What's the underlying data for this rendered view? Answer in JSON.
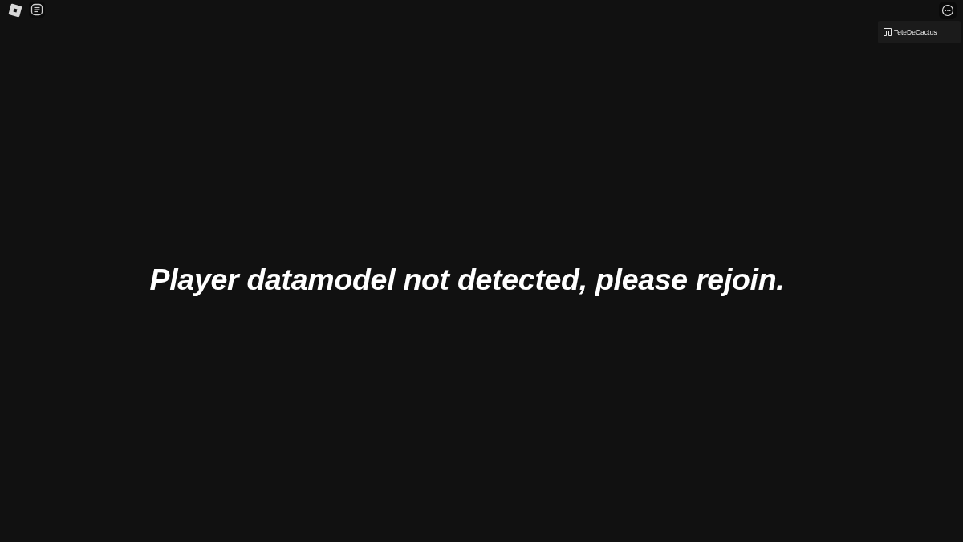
{
  "player_list": [
    {
      "name": "TeteDeCactus"
    }
  ],
  "message": "Player datamodel not detected, please rejoin."
}
